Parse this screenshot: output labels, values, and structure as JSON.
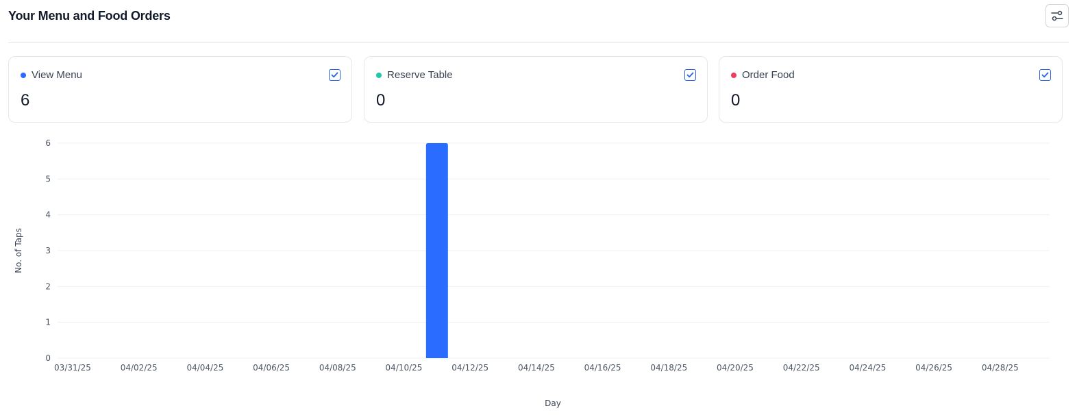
{
  "header": {
    "title": "Your Menu and Food Orders",
    "filter_icon": "sliders-icon"
  },
  "cards": [
    {
      "label": "View Menu",
      "value": "6",
      "color": "#2a6cff",
      "checked": true
    },
    {
      "label": "Reserve Table",
      "value": "0",
      "color": "#22c7a9",
      "checked": true
    },
    {
      "label": "Order Food",
      "value": "0",
      "color": "#ef3b5f",
      "checked": true
    }
  ],
  "chart_data": {
    "type": "bar",
    "xlabel": "Day",
    "ylabel": "No. of Taps",
    "ylim": [
      0,
      6
    ],
    "yticks": [
      "0",
      "1",
      "2",
      "3",
      "4",
      "5",
      "6"
    ],
    "xticks": [
      "03/31/25",
      "04/02/25",
      "04/04/25",
      "04/06/25",
      "04/08/25",
      "04/10/25",
      "04/12/25",
      "04/14/25",
      "04/16/25",
      "04/18/25",
      "04/20/25",
      "04/22/25",
      "04/24/25",
      "04/26/25",
      "04/28/25"
    ],
    "grid": true,
    "series": [
      {
        "name": "View Menu",
        "color": "#2a6cff",
        "points": [
          {
            "x": "04/11/25",
            "y": 6
          }
        ]
      }
    ]
  }
}
